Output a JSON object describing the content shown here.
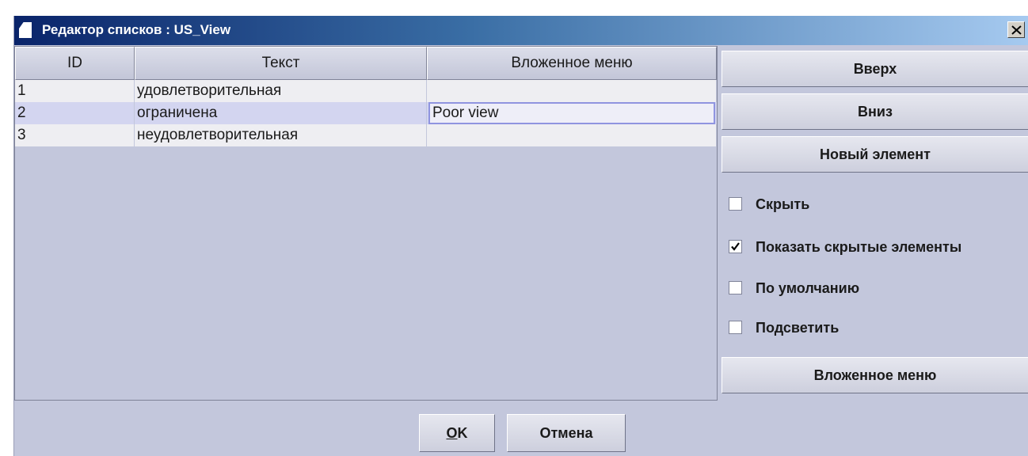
{
  "window": {
    "title": "Редактор списков : US_View",
    "close_symbol": "×"
  },
  "table": {
    "columns": [
      "ID",
      "Текст",
      "Вложенное меню"
    ],
    "rows": [
      {
        "id": "1",
        "text": "удовлетворительная",
        "submenu": "",
        "selected": false
      },
      {
        "id": "2",
        "text": "ограничена",
        "submenu": "Poor view",
        "selected": true
      },
      {
        "id": "3",
        "text": "неудовлетворительная",
        "submenu": "",
        "selected": false
      }
    ]
  },
  "side": {
    "up_label": "Вверх",
    "down_label": "Вниз",
    "new_item_label": "Новый элемент",
    "submenu_label": "Вложенное меню",
    "checkboxes": [
      {
        "label": "Скрыть",
        "checked": false
      },
      {
        "label": "Показать скрытые элементы",
        "checked": true
      },
      {
        "label": "По умолчанию",
        "checked": false
      },
      {
        "label": "Подсветить",
        "checked": false
      }
    ]
  },
  "footer": {
    "ok_mnemonic": "O",
    "ok_rest": "K",
    "cancel_label": "Отмена"
  },
  "colors": {
    "title_gradient_start": "#0a246a",
    "title_gradient_end": "#a6caf0",
    "window_bg": "#c3c7dc",
    "row_bg": "#eeeef2",
    "selected_row_bg": "#d3d5f0",
    "focus_border": "#8f94e0"
  }
}
